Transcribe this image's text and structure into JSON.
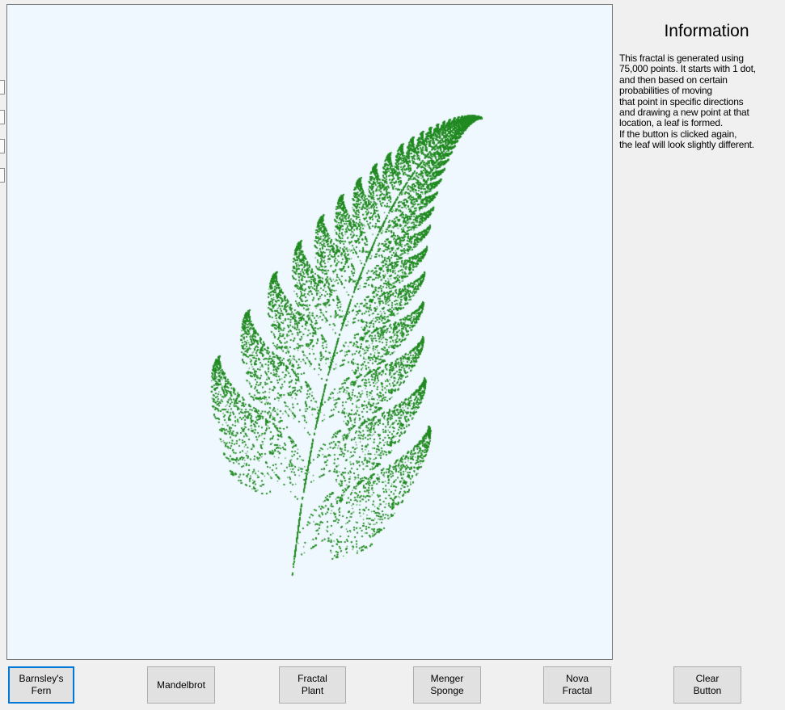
{
  "info": {
    "title": "Information",
    "lines": [
      "This fractal is generated using",
      "75,000 points. It starts with 1 dot,",
      "and then based on certain",
      "probabilities of moving",
      "that point in specific directions",
      "and drawing a new point at that",
      "location, a leaf is formed.",
      "If the button is clicked again,",
      "the leaf will look slightly different."
    ]
  },
  "buttons": {
    "barnsley": "Barnsley's\nFern",
    "mandelbrot": "Mandelbrot",
    "fractal_plant": "Fractal\nPlant",
    "menger": "Menger\nSponge",
    "nova": "Nova\nFractal",
    "clear": "Clear\nButton"
  },
  "colors": {
    "canvas_background": "#f0f8ff",
    "fern": "#228b22",
    "active_button_border": "#0078d7"
  },
  "fractal": {
    "type": "barnsley-fern",
    "points": 75000
  }
}
